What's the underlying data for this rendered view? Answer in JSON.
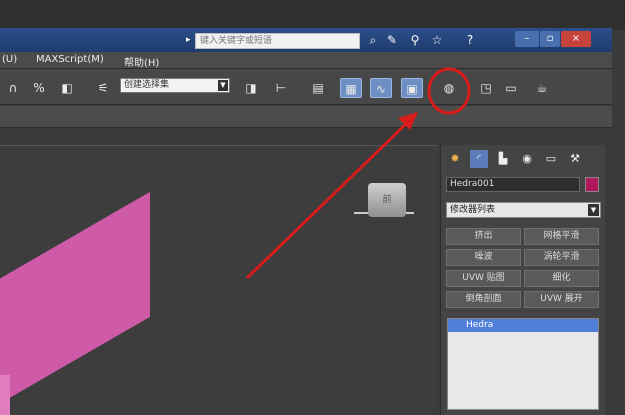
{
  "menubar": {
    "items": [
      {
        "label": "(U)"
      },
      {
        "label": "MAXScript(M)"
      },
      {
        "label": "帮助(H)"
      }
    ]
  },
  "titlebar": {
    "search_placeholder": "键入关键字或短语",
    "icons": [
      "binoculars-icon",
      "wrench-icon",
      "star-icon",
      "help-icon"
    ],
    "window_buttons": {
      "minimize": "–",
      "restore": "▫",
      "close": "×"
    }
  },
  "toolbar": {
    "selection_set_placeholder": "创建选择集",
    "icons": [
      "snap-toggle-icon",
      "percent-snap-icon",
      "spinner-snap-icon",
      "edit-named-sel-icon",
      "mirror-icon",
      "align-icon",
      "layer-manager-icon",
      "curve-editor-icon",
      "schematic-view-icon",
      "material-editor-icon",
      "render-setup-icon",
      "rendered-frame-icon",
      "render-icon"
    ]
  },
  "command_panel": {
    "tabs": [
      "create-tab-icon",
      "modify-tab-icon",
      "hierarchy-tab-icon",
      "motion-tab-icon",
      "display-tab-icon",
      "utilities-tab-icon"
    ],
    "object_name": "Hedra001",
    "object_color": "#b0185d",
    "modifier_list_label": "修改器列表",
    "modifier_buttons": [
      [
        "挤出",
        "网格平滑"
      ],
      [
        "噪波",
        "涡轮平滑"
      ],
      [
        "UVW 贴图",
        "细化"
      ],
      [
        "倒角剖面",
        "UVW 展开"
      ]
    ],
    "stack_items": [
      "Hedra"
    ]
  },
  "viewport": {
    "viewcube_label": "前"
  },
  "annotation": {
    "arrow_color": "#d81c1c",
    "circle_color": "#d81c1c"
  }
}
